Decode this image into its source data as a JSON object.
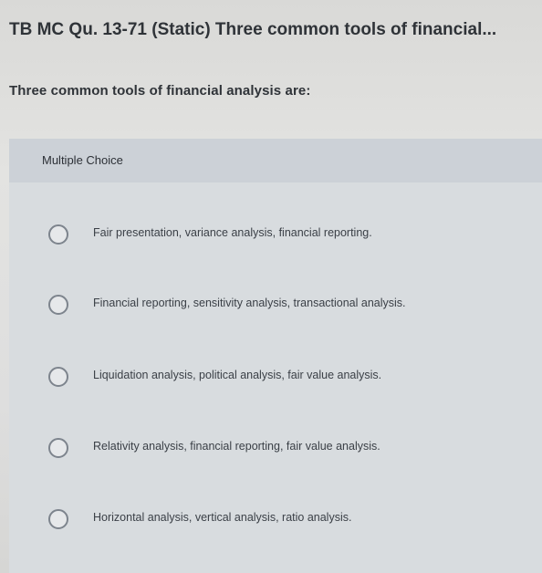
{
  "question": {
    "title": "TB MC Qu. 13-71 (Static) Three common tools of financial...",
    "stem": "Three common tools of financial analysis are:"
  },
  "multiple_choice": {
    "header_label": "Multiple Choice",
    "options": [
      {
        "label": "Fair presentation, variance analysis, financial reporting."
      },
      {
        "label": "Financial reporting, sensitivity analysis, transactional analysis."
      },
      {
        "label": "Liquidation analysis, political analysis, fair value analysis."
      },
      {
        "label": "Relativity analysis, financial reporting, fair value analysis."
      },
      {
        "label": "Horizontal analysis, vertical analysis, ratio analysis."
      }
    ]
  },
  "icons": {
    "radio": "radio-unselected-icon"
  },
  "colors": {
    "panel_background": "#d8dcdf",
    "header_background": "#ccd1d7",
    "radio_border": "#7d848d"
  }
}
